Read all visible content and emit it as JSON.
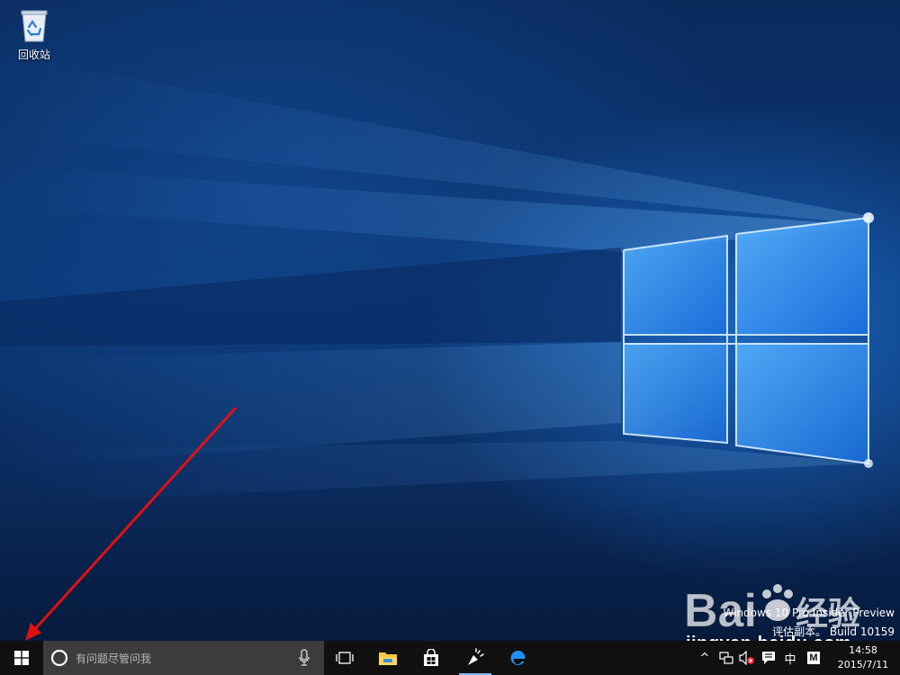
{
  "desktop": {
    "icons": [
      {
        "label": "回收站",
        "icon": "recycle-bin-icon"
      }
    ],
    "watermark": {
      "line1": "Windows 10 Pro Insider Preview",
      "line2": "评估副本。 Build 10159"
    },
    "overlay": {
      "baidu_logo_text": "Bai 经验",
      "baidu_url": "jingyan.baidu.com"
    }
  },
  "taskbar": {
    "start_icon": "windows-logo-icon",
    "search": {
      "placeholder": "有问题尽管问我",
      "left_icon": "cortana-icon",
      "right_icon": "microphone-icon"
    },
    "pinned": [
      {
        "icon": "task-view-icon"
      },
      {
        "icon": "file-explorer-icon"
      },
      {
        "icon": "store-icon"
      },
      {
        "icon": "tips-icon",
        "active": true
      },
      {
        "icon": "edge-icon"
      }
    ],
    "tray": {
      "chevron": "^",
      "ime": "中",
      "ime_mode": "M",
      "time": "14:58",
      "date": "2015/7/11"
    }
  },
  "colors": {
    "taskbar": "#101010",
    "search_box": "#3c3c3c",
    "accent": "#1e8fff",
    "annotation_arrow": "#e01010"
  }
}
